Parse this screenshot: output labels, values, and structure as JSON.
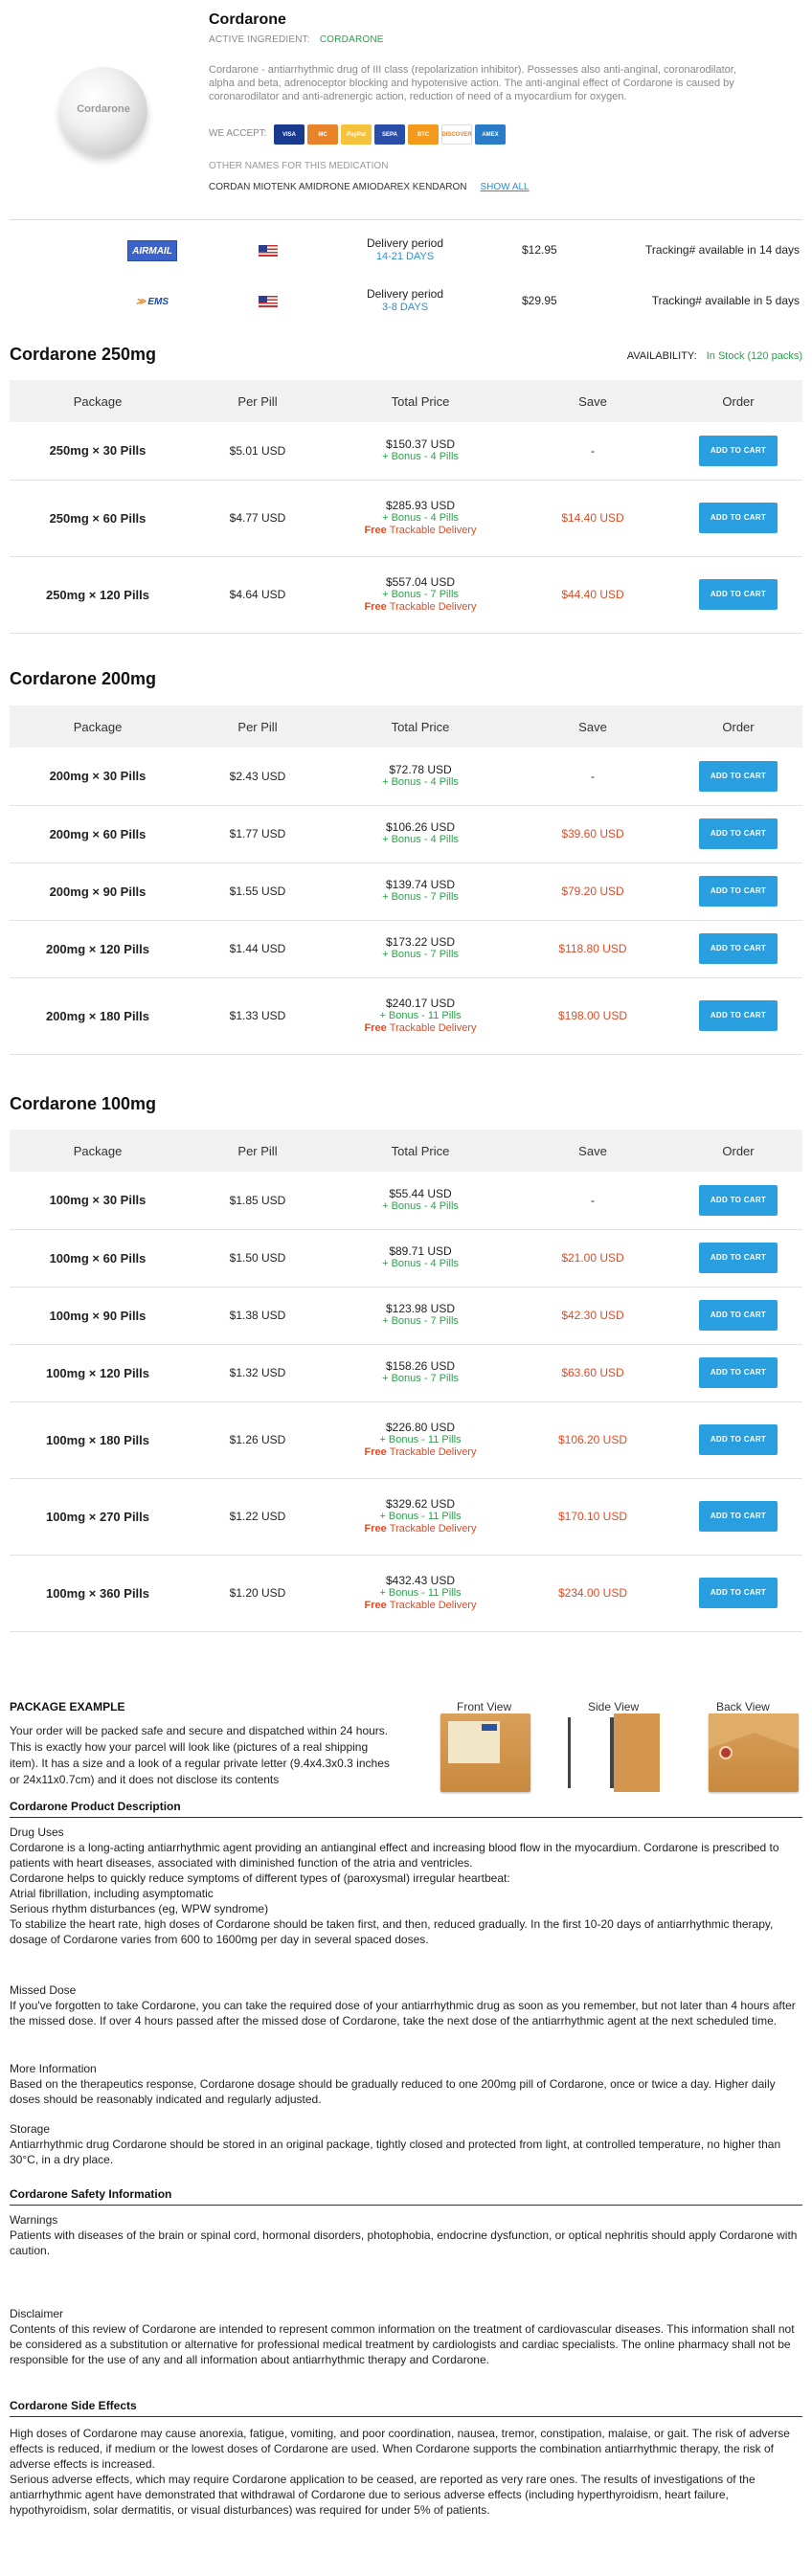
{
  "product": {
    "title": "Cordarone",
    "active_label": "ACTIVE INGREDIENT:",
    "active_value": "CORDARONE",
    "pill_label": "Cordarone",
    "description": "Cordarone - antiarrhythmic drug of III class (repolarization inhibitor). Possesses also anti-anginal, coronarodilator, alpha and beta, adrenoceptor blocking and hypotensive action. The anti-anginal effect of Cordarone is caused by coronarodilator and anti-adrenergic action, reduction of need of a myocardium for oxygen.",
    "we_accept": "WE ACCEPT:",
    "cards": [
      {
        "name": "VISA",
        "color": "#1a3a8f"
      },
      {
        "name": "MC",
        "color": "#e8832a"
      },
      {
        "name": "PayPal",
        "color": "#f5c33b"
      },
      {
        "name": "SEPA",
        "color": "#2a4ea8"
      },
      {
        "name": "BTC",
        "color": "#f39a1c"
      },
      {
        "name": "DISCOVER",
        "color": "#ffffff"
      },
      {
        "name": "AMEX",
        "color": "#2a7bc8"
      }
    ],
    "other_names_label": "OTHER NAMES FOR THIS MEDICATION",
    "other_names": "CORDAN MIOTENK AMIDRONE AMIODAREX KENDARON",
    "show_all": "SHOW ALL"
  },
  "shipping": [
    {
      "logo": "AIRMAIL",
      "period_label": "Delivery period",
      "days": "14-21 DAYS",
      "price": "$12.95",
      "tracking": "Tracking# available in 14 days"
    },
    {
      "logo": "EMS",
      "period_label": "Delivery period",
      "days": "3-8 DAYS",
      "price": "$29.95",
      "tracking": "Tracking# available in 5 days"
    }
  ],
  "availability": {
    "label": "AVAILABILITY:",
    "value": "In Stock (120 packs)"
  },
  "table_headers": [
    "Package",
    "Per Pill",
    "Total Price",
    "Save",
    "Order"
  ],
  "cart_label": "ADD TO CART",
  "sections": [
    {
      "title": "Cordarone 250mg",
      "rows": [
        {
          "pkg": "250mg × 30 Pills",
          "per": "$5.01 USD",
          "total": "$150.37 USD",
          "bonus": "+ Bonus - 4 Pills",
          "free": "",
          "save": "-"
        },
        {
          "pkg": "250mg × 60 Pills",
          "per": "$4.77 USD",
          "total": "$285.93 USD",
          "bonus": "+ Bonus - 4 Pills",
          "free": "Trackable Delivery",
          "save": "$14.40 USD"
        },
        {
          "pkg": "250mg × 120 Pills",
          "per": "$4.64 USD",
          "total": "$557.04 USD",
          "bonus": "+ Bonus - 7 Pills",
          "free": "Trackable Delivery",
          "save": "$44.40 USD"
        }
      ]
    },
    {
      "title": "Cordarone 200mg",
      "rows": [
        {
          "pkg": "200mg × 30 Pills",
          "per": "$2.43 USD",
          "total": "$72.78 USD",
          "bonus": "+ Bonus - 4 Pills",
          "free": "",
          "save": "-"
        },
        {
          "pkg": "200mg × 60 Pills",
          "per": "$1.77 USD",
          "total": "$106.26 USD",
          "bonus": "+ Bonus - 4 Pills",
          "free": "",
          "save": "$39.60 USD"
        },
        {
          "pkg": "200mg × 90 Pills",
          "per": "$1.55 USD",
          "total": "$139.74 USD",
          "bonus": "+ Bonus - 7 Pills",
          "free": "",
          "save": "$79.20 USD"
        },
        {
          "pkg": "200mg × 120 Pills",
          "per": "$1.44 USD",
          "total": "$173.22 USD",
          "bonus": "+ Bonus - 7 Pills",
          "free": "",
          "save": "$118.80 USD"
        },
        {
          "pkg": "200mg × 180 Pills",
          "per": "$1.33 USD",
          "total": "$240.17 USD",
          "bonus": "+ Bonus - 11 Pills",
          "free": "Trackable Delivery",
          "save": "$198.00 USD"
        }
      ]
    },
    {
      "title": "Cordarone 100mg",
      "rows": [
        {
          "pkg": "100mg × 30 Pills",
          "per": "$1.85 USD",
          "total": "$55.44 USD",
          "bonus": "+ Bonus - 4 Pills",
          "free": "",
          "save": "-"
        },
        {
          "pkg": "100mg × 60 Pills",
          "per": "$1.50 USD",
          "total": "$89.71 USD",
          "bonus": "+ Bonus - 4 Pills",
          "free": "",
          "save": "$21.00 USD"
        },
        {
          "pkg": "100mg × 90 Pills",
          "per": "$1.38 USD",
          "total": "$123.98 USD",
          "bonus": "+ Bonus - 7 Pills",
          "free": "",
          "save": "$42.30 USD"
        },
        {
          "pkg": "100mg × 120 Pills",
          "per": "$1.32 USD",
          "total": "$158.26 USD",
          "bonus": "+ Bonus - 7 Pills",
          "free": "",
          "save": "$63.60 USD"
        },
        {
          "pkg": "100mg × 180 Pills",
          "per": "$1.26 USD",
          "total": "$226.80 USD",
          "bonus": "+ Bonus - 11 Pills",
          "free": "Trackable Delivery",
          "save": "$106.20 USD"
        },
        {
          "pkg": "100mg × 270 Pills",
          "per": "$1.22 USD",
          "total": "$329.62 USD",
          "bonus": "+ Bonus - 11 Pills",
          "free": "Trackable Delivery",
          "save": "$170.10 USD"
        },
        {
          "pkg": "100mg × 360 Pills",
          "per": "$1.20 USD",
          "total": "$432.43 USD",
          "bonus": "+ Bonus - 11 Pills",
          "free": "Trackable Delivery",
          "save": "$234.00 USD"
        }
      ]
    }
  ],
  "free_word": "Free",
  "package_example": {
    "title": "PACKAGE EXAMPLE",
    "text": "Your order will be packed safe and secure and dispatched within 24 hours. This is exactly how your parcel will look like (pictures of a real shipping item). It has a size and a look of a regular private letter (9.4x4.3x0.3 inches or 24x11x0.7cm) and it does not disclose its contents",
    "front": "Front View",
    "side": "Side View",
    "back": "Back View"
  },
  "desc_section": {
    "title": "Cordarone Product Description",
    "drug_uses_title": "Drug Uses",
    "drug_uses": [
      "Cordarone is a long-acting antiarrhythmic agent providing an antianginal effect and increasing blood flow in the myocardium. Cordarone is prescribed to patients with heart diseases, associated with diminished function of the atria and ventricles.",
      "Cordarone helps to quickly reduce symptoms of different types of (paroxysmal) irregular heartbeat:",
      "Atrial fibrillation, including asymptomatic",
      "Serious rhythm disturbances (eg, WPW syndrome)",
      "To stabilize the heart rate, high doses of Cordarone should be taken first, and then, reduced gradually. In the first 10-20 days of antiarrhythmic therapy, dosage of Cordarone varies from 600 to 1600mg per day in several spaced doses."
    ],
    "missed_title": "Missed Dose",
    "missed": "If you've forgotten to take Cordarone, you can take the required dose of your antiarrhythmic drug as soon as you remember, but not later than 4 hours after the missed dose. If over 4 hours passed after the missed dose of Cordarone, take the next dose of the antiarrhythmic agent at the next scheduled time.",
    "more_title": "More Information",
    "more": "Based on the therapeutics response, Cordarone dosage should be gradually reduced to one 200mg pill of Cordarone, once or twice a day. Higher daily doses should be reasonably indicated and regularly adjusted.",
    "storage_title": "Storage",
    "storage": "Antiarrhythmic drug Cordarone should be stored in an original package, tightly closed and protected from light, at controlled temperature, no higher than 30°C, in a dry place."
  },
  "safety": {
    "title": "Cordarone Safety Information",
    "warnings_title": "Warnings",
    "warnings": "Patients with diseases of the brain or spinal cord, hormonal disorders, photophobia, endocrine dysfunction, or optical nephritis should apply Cordarone with caution.",
    "disclaimer_title": "Disclaimer",
    "disclaimer": "Contents of this review of Cordarone are intended to represent common information on the treatment of cardiovascular diseases. This information shall not be considered as a substitution or alternative for professional medical treatment by cardiologists and cardiac specialists. The online pharmacy shall not be responsible for the use of any and all information about antiarrhythmic therapy and Cordarone."
  },
  "side_effects": {
    "title": "Cordarone Side Effects",
    "p1": "High doses of Cordarone may cause anorexia, fatigue, vomiting, and poor coordination, nausea, tremor, constipation, malaise, or gait. The risk of adverse effects is reduced, if medium or the lowest doses of Cordarone are used. When Cordarone supports the combination antiarrhythmic therapy, the risk of adverse effects is increased.",
    "p2": "Serious adverse effects, which may require Cordarone application to be ceased, are reported as very rare ones. The results of investigations of the antiarrhythmic agent have demonstrated that withdrawal of Cordarone due to serious adverse effects (including hyperthyroidism, heart failure, hypothyroidism, solar dermatitis, or visual disturbances) was required for under 5% of patients."
  }
}
